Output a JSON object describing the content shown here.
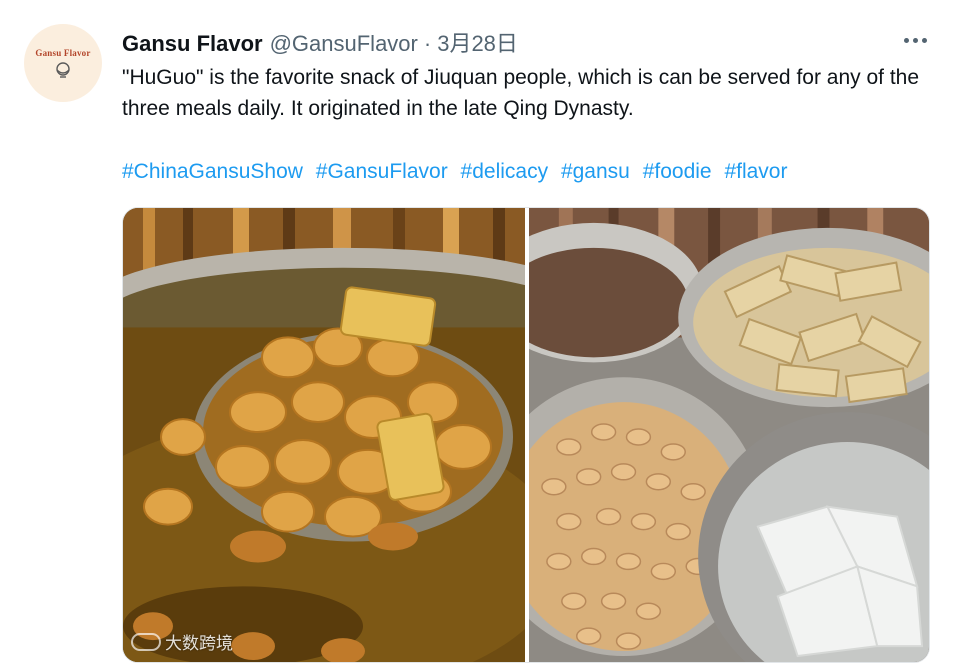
{
  "tweet": {
    "avatar_text": "Gansu Flavor",
    "display_name": "Gansu Flavor",
    "handle": "@GansuFlavor",
    "separator": "·",
    "timestamp": "3月28日",
    "text": "\"HuGuo\" is the favorite snack of Jiuquan people, which is can be served for any of the three meals daily. It originated in the late Qing Dynasty.",
    "hashtags": [
      "#ChinaGansuShow",
      "#GansuFlavor",
      "#delicacy",
      "#gansu",
      "#foodie",
      "#flavor"
    ]
  },
  "watermark": {
    "text": "大数跨境"
  },
  "colors": {
    "link": "#1d9bf0",
    "secondary_text": "#536471",
    "primary_text": "#0f1419",
    "avatar_bg": "#fbeede",
    "avatar_brand": "#b3452a"
  }
}
